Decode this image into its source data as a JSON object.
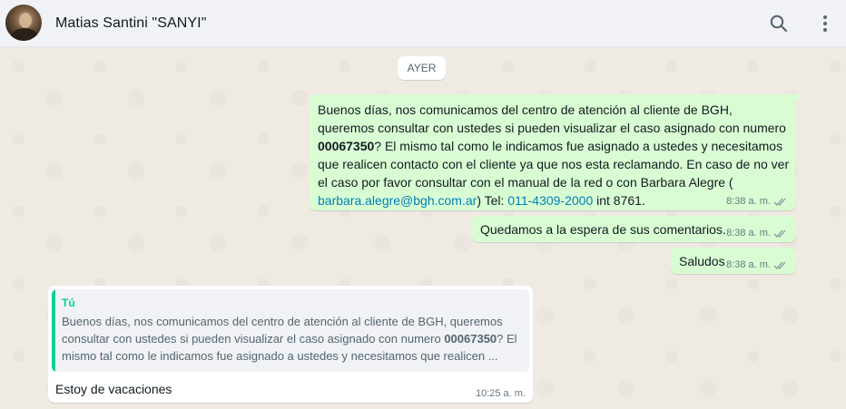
{
  "header": {
    "contact_name": "Matias Santini \"SANYI\""
  },
  "date_chip": "AYER",
  "messages": [
    {
      "text_parts": [
        "Buenos días, nos comunicamos del centro de atención al cliente de BGH, queremos consultar con ustedes si pueden visualizar el caso asignado con numero ",
        "00067350",
        "? El mismo tal como le indicamos fue asignado a ustedes y necesitamos que realicen contacto con el cliente ya que nos esta reclamando. En caso de no ver el caso por favor consultar con el manual de la red o con Barbara Alegre ( ",
        "barbara.alegre@bgh.com.ar",
        ") Tel: ",
        "011-4309-2000",
        " int 8761."
      ],
      "time": "8:38 a. m."
    },
    {
      "text": "Quedamos a la espera de sus comentarios.",
      "time": "8:38 a. m."
    },
    {
      "text": "Saludos",
      "time": "8:38 a. m."
    },
    {
      "quote": {
        "author": "Tú",
        "text_parts": [
          "Buenos días, nos comunicamos del centro de atención al cliente de BGH, queremos consultar con ustedes si pueden visualizar el caso asignado con numero ",
          "00067350",
          "? El mismo tal como le indicamos fue asignado a ustedes y necesitamos que realicen ..."
        ]
      },
      "text": "Estoy de vacaciones",
      "time": "10:25 a. m."
    }
  ],
  "colors": {
    "outgoing_bubble": "#d9fdd3",
    "incoming_bubble": "#ffffff",
    "link": "#027eb5",
    "quote_accent": "#06cf9c",
    "read_ticks": "#8696a0"
  },
  "icons": [
    "search-icon",
    "menu-icon",
    "double-check-icon"
  ]
}
